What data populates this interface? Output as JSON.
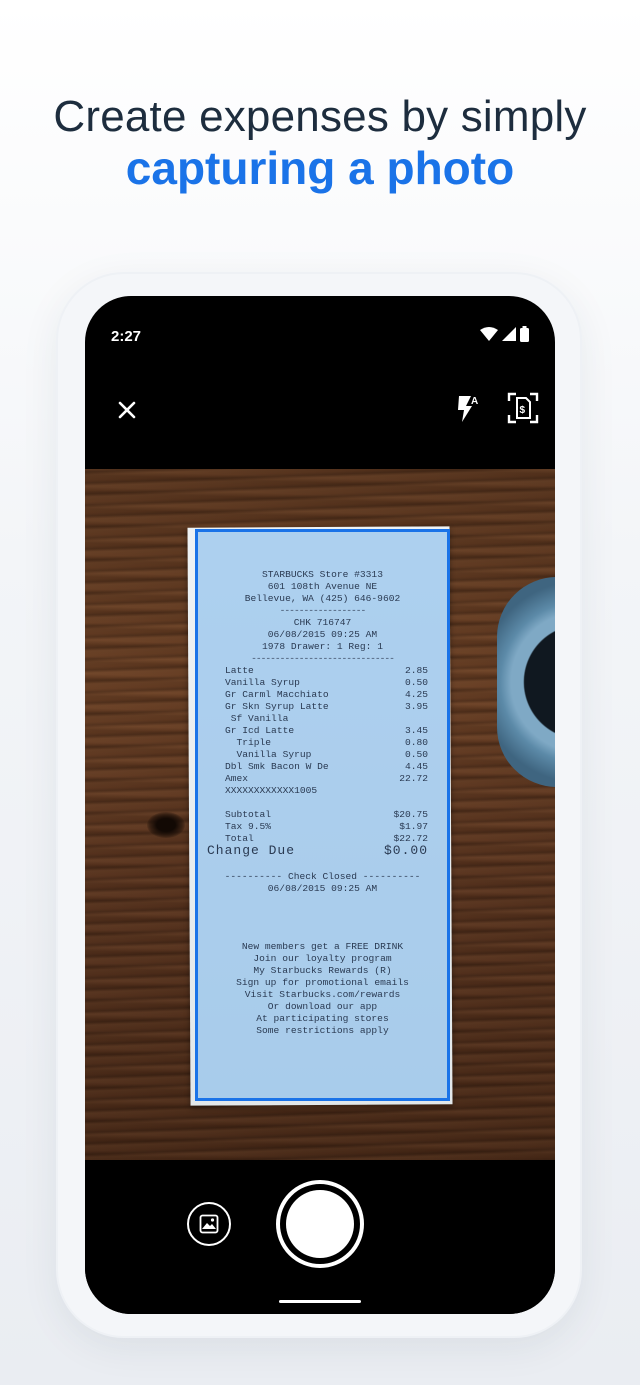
{
  "headline": {
    "line1": "Create expenses by simply",
    "line2": "capturing a photo"
  },
  "status_bar": {
    "time": "2:27",
    "icons": [
      "wifi-icon",
      "signal-icon",
      "battery-icon"
    ]
  },
  "toolbar": {
    "close_icon": "close-icon",
    "flash_icon": "flash-auto-icon",
    "flash_label": "A",
    "scan_icon": "document-scan-icon"
  },
  "receipt": {
    "store": "STARBUCKS Store #3313",
    "address": "601 108th Avenue NE",
    "city": "Bellevue, WA (425) 646-9602",
    "check": "CHK 716747",
    "datetime": "06/08/2015 09:25 AM",
    "drawer": "1978  Drawer: 1  Reg: 1",
    "items": [
      {
        "name": "Latte",
        "price": "2.85"
      },
      {
        "name": "Vanilla Syrup",
        "price": "0.50"
      },
      {
        "name": "Gr Carml Macchiato",
        "price": "4.25"
      },
      {
        "name": "Gr Skn Syrup Latte",
        "price": "3.95"
      },
      {
        "name": " Sf Vanilla",
        "price": ""
      },
      {
        "name": "Gr Icd Latte",
        "price": "3.45"
      },
      {
        "name": "  Triple",
        "price": "0.80"
      },
      {
        "name": "  Vanilla Syrup",
        "price": "0.50"
      },
      {
        "name": "Dbl Smk Bacon W De",
        "price": "4.45"
      },
      {
        "name": "Amex",
        "price": "22.72"
      },
      {
        "name": "XXXXXXXXXXXX1005",
        "price": ""
      }
    ],
    "subtotal_label": "Subtotal",
    "subtotal": "$20.75",
    "tax_label": "Tax 9.5%",
    "tax": "$1.97",
    "total_label": "Total",
    "total": "$22.72",
    "change_label": "Change Due",
    "change": "$0.00",
    "closed_label": "Check Closed",
    "closed_datetime": "06/08/2015 09:25 AM",
    "footer": [
      "New members get a FREE DRINK",
      "Join our loyalty program",
      "My Starbucks Rewards (R)",
      "Sign up for promotional emails",
      "Visit Starbucks.com/rewards",
      "Or download our app",
      "At participating stores",
      "Some restrictions apply"
    ]
  },
  "bottom": {
    "gallery_icon": "gallery-icon",
    "shutter_icon": "shutter-button"
  },
  "colors": {
    "accent": "#1a73e8",
    "headline_text": "#1d2d3e",
    "overlay": "#78b4eb"
  }
}
